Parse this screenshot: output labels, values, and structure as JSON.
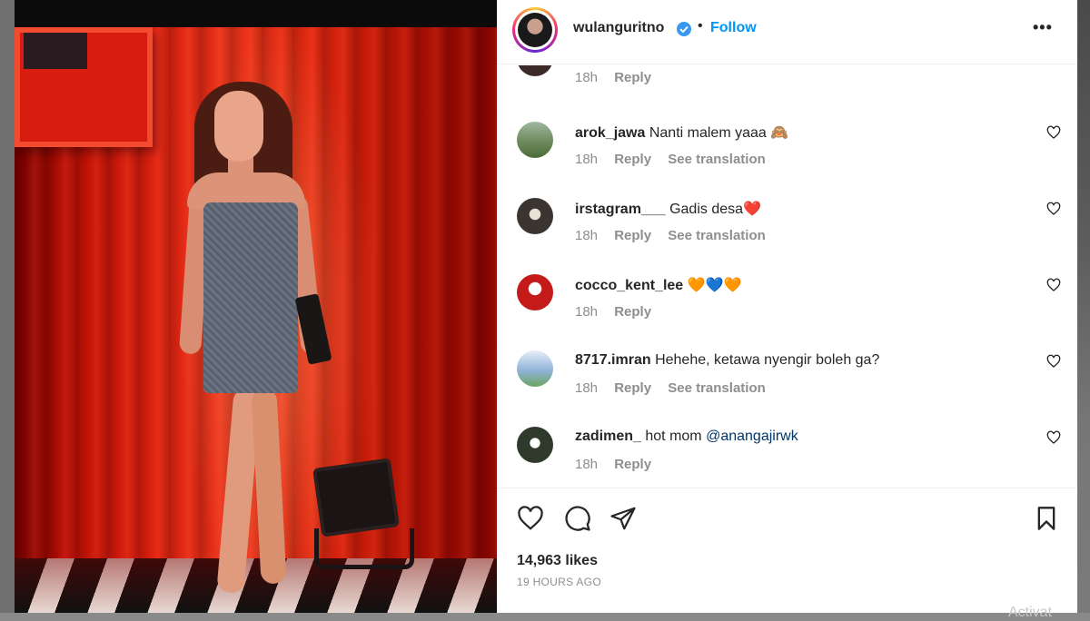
{
  "post": {
    "username": "wulanguritno",
    "follow_label": "Follow",
    "separator": "•",
    "likes": "14,963 likes",
    "time_ago": "19 HOURS AGO",
    "watermark": "Activat"
  },
  "comments": [
    {
      "user": "",
      "text": "",
      "time": "18h",
      "reply": "Reply",
      "translate": ""
    },
    {
      "user": "arok_jawa",
      "text": "Nanti malem yaaa 🙈",
      "time": "18h",
      "reply": "Reply",
      "translate": "See translation"
    },
    {
      "user": "irstagram___",
      "text": "Gadis desa❤️",
      "time": "18h",
      "reply": "Reply",
      "translate": "See translation"
    },
    {
      "user": "cocco_kent_lee",
      "text": "🧡💙🧡",
      "time": "18h",
      "reply": "Reply",
      "translate": ""
    },
    {
      "user": "8717.imran",
      "text": "Hehehe, ketawa nyengir boleh ga?",
      "time": "18h",
      "reply": "Reply",
      "translate": "See translation"
    },
    {
      "user": "zadimen_",
      "text": "hot mom",
      "mention": "@anangajirwk",
      "time": "18h",
      "reply": "Reply",
      "translate": ""
    }
  ],
  "colors": {
    "accent": "#0095f6",
    "text": "#262626",
    "muted": "#8e8e8e",
    "verified": "#3897f0"
  },
  "icons": [
    "verified-icon",
    "more-icon",
    "heart-icon",
    "comment-icon",
    "share-icon",
    "bookmark-icon",
    "user-icon"
  ]
}
